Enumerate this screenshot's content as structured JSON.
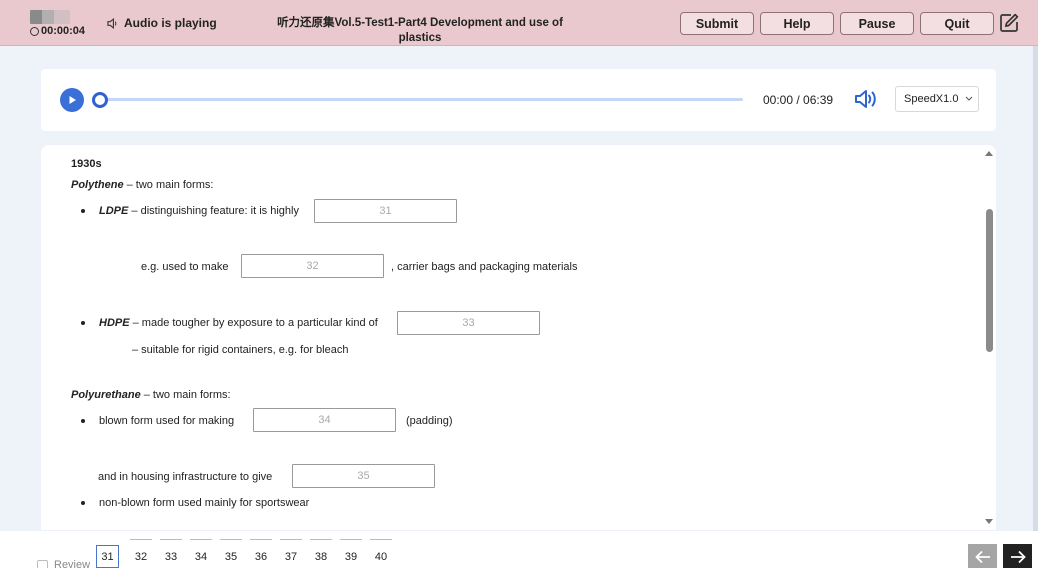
{
  "header": {
    "timer": "00:00:04",
    "audio_status": "Audio is playing",
    "title": "听力还原集Vol.5-Test1-Part4 Development and use of plastics",
    "buttons": {
      "submit": "Submit",
      "help": "Help",
      "pause": "Pause",
      "quit": "Quit"
    },
    "icons": {
      "clock": "clock-icon",
      "speaker": "speaker-icon",
      "edit": "edit-note-icon"
    }
  },
  "player": {
    "time": "00:00 / 06:39",
    "progress": 0.0,
    "speed": "SpeedX1.0",
    "icons": {
      "play": "play-icon",
      "volume": "volume-icon",
      "dropdown": "chevron-down-icon"
    }
  },
  "content": {
    "era": "1930s",
    "polythene": {
      "name": "Polythene",
      "rest": " – two main forms:"
    },
    "ldpe": {
      "name": "LDPE",
      "rest": " – distinguishing feature: it is highly"
    },
    "ldpe_eg": "e.g. used to make",
    "ldpe_after": ", carrier bags and packaging materials",
    "hdpe": {
      "name": "HDPE",
      "rest": " – made tougher by exposure to a particular kind of"
    },
    "hdpe_suitable": "– suitable for rigid containers, e.g. for bleach",
    "polyurethane": {
      "name": "Polyurethane",
      "rest": " – two main forms:"
    },
    "blown": "blown form used for making",
    "padding": "(padding)",
    "housing": "and in housing infrastructure to give",
    "non_blown": "non-blown form used mainly for sportswear",
    "gaps": [
      {
        "placeholder": "31",
        "value": ""
      },
      {
        "placeholder": "32",
        "value": ""
      },
      {
        "placeholder": "33",
        "value": ""
      },
      {
        "placeholder": "34",
        "value": ""
      },
      {
        "placeholder": "35",
        "value": ""
      }
    ]
  },
  "footer": {
    "review": "Review",
    "questions": [
      "31",
      "32",
      "33",
      "34",
      "35",
      "36",
      "37",
      "38",
      "39",
      "40"
    ],
    "active_question": "31",
    "icons": {
      "prev": "arrow-left-icon",
      "next": "arrow-right-icon"
    }
  },
  "colors": {
    "header_bg": "#e9c9cd",
    "accent_blue": "#3a6fd8",
    "page_bg": "#eef2f9"
  }
}
